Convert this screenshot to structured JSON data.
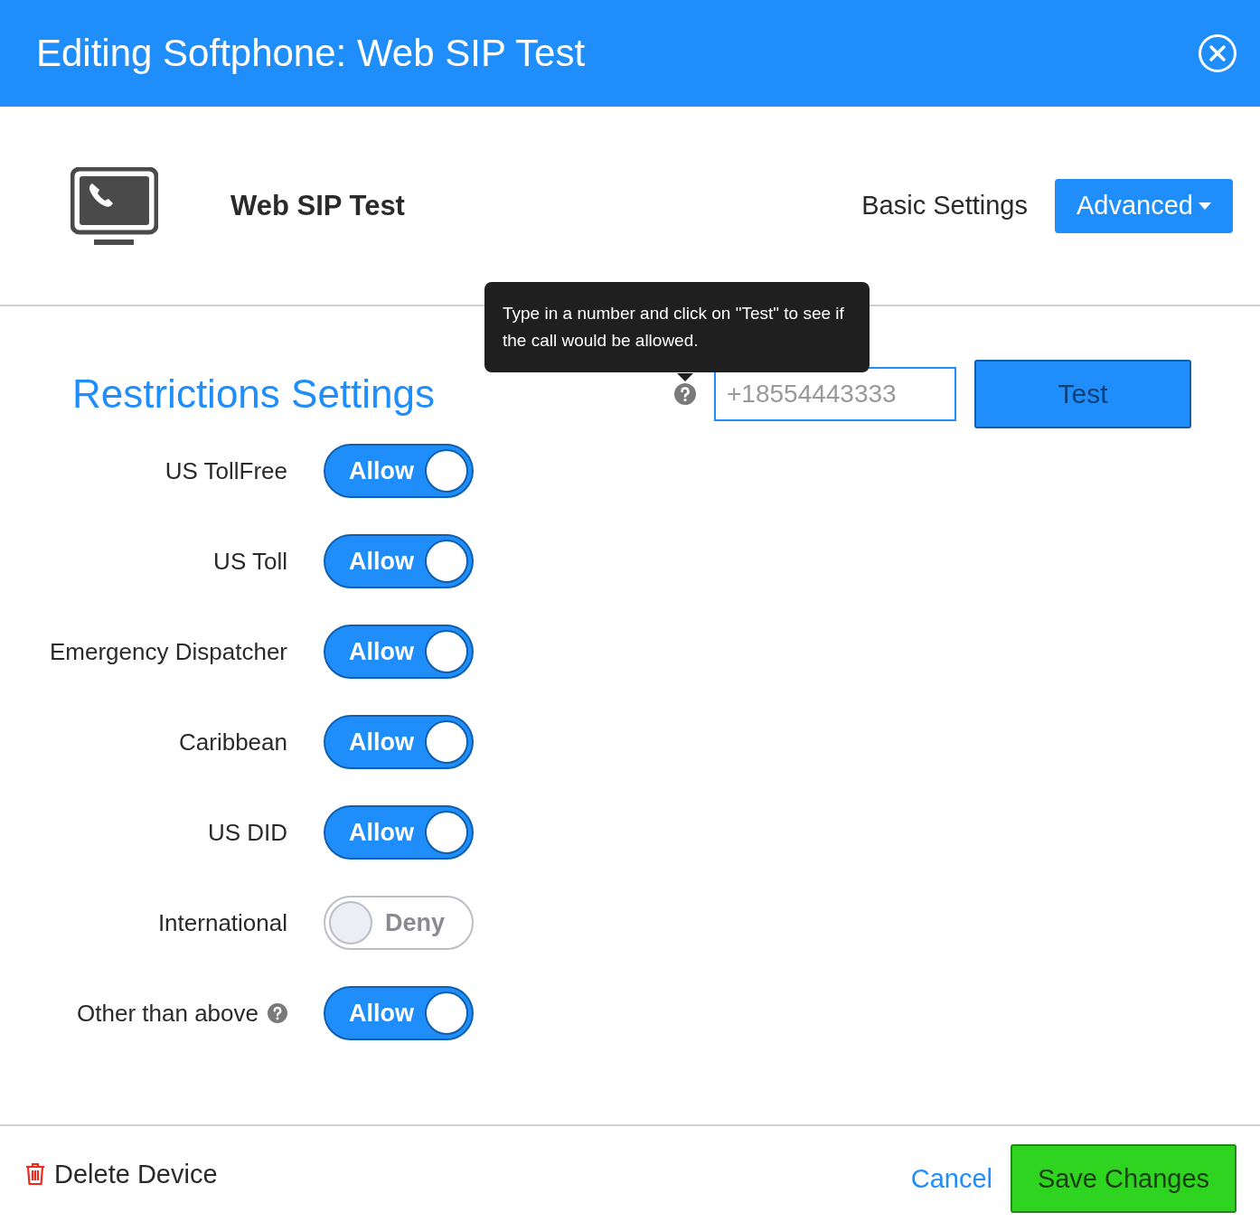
{
  "header": {
    "title": "Editing Softphone: Web SIP Test"
  },
  "device": {
    "name": "Web SIP Test"
  },
  "tabs": [
    {
      "label": "Basic Settings",
      "selected": false,
      "dropdown": false
    },
    {
      "label": "Advanced",
      "selected": true,
      "dropdown": true
    }
  ],
  "section": {
    "title": "Restrictions Settings"
  },
  "tester": {
    "tooltip": "Type in a number and click on \"Test\" to see if the call would be allowed.",
    "placeholder": "+18554443333",
    "button": "Test"
  },
  "restrictions": [
    {
      "label": "US TollFree",
      "on": true,
      "state_label": "Allow",
      "help": false
    },
    {
      "label": "US Toll",
      "on": true,
      "state_label": "Allow",
      "help": false
    },
    {
      "label": "Emergency Dispatcher",
      "on": true,
      "state_label": "Allow",
      "help": false
    },
    {
      "label": "Caribbean",
      "on": true,
      "state_label": "Allow",
      "help": false
    },
    {
      "label": "US DID",
      "on": true,
      "state_label": "Allow",
      "help": false
    },
    {
      "label": "International",
      "on": false,
      "state_label": "Deny",
      "help": false
    },
    {
      "label": "Other than above",
      "on": true,
      "state_label": "Allow",
      "help": true
    }
  ],
  "footer": {
    "delete": "Delete Device",
    "cancel": "Cancel",
    "save": "Save Changes"
  }
}
